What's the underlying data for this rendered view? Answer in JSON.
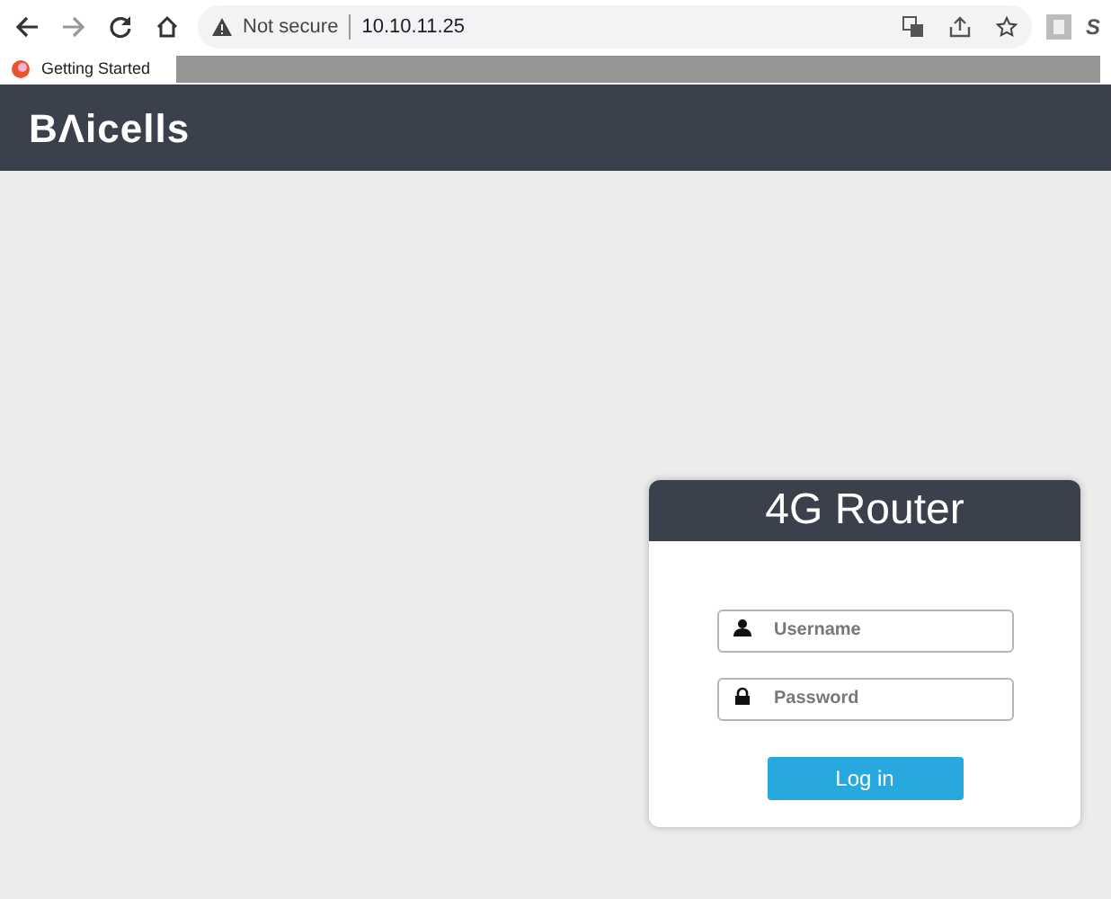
{
  "browser": {
    "security_label": "Not secure",
    "url": "10.10.11.25",
    "extension_letter": "S"
  },
  "bookmarks": [
    {
      "label": "Getting Started"
    }
  ],
  "header": {
    "logo": "BΛicells"
  },
  "login": {
    "title": "4G Router",
    "fields": [
      {
        "kind": "user",
        "placeholder": "Username"
      },
      {
        "kind": "password",
        "placeholder": "Password"
      }
    ],
    "button": "Log in"
  }
}
